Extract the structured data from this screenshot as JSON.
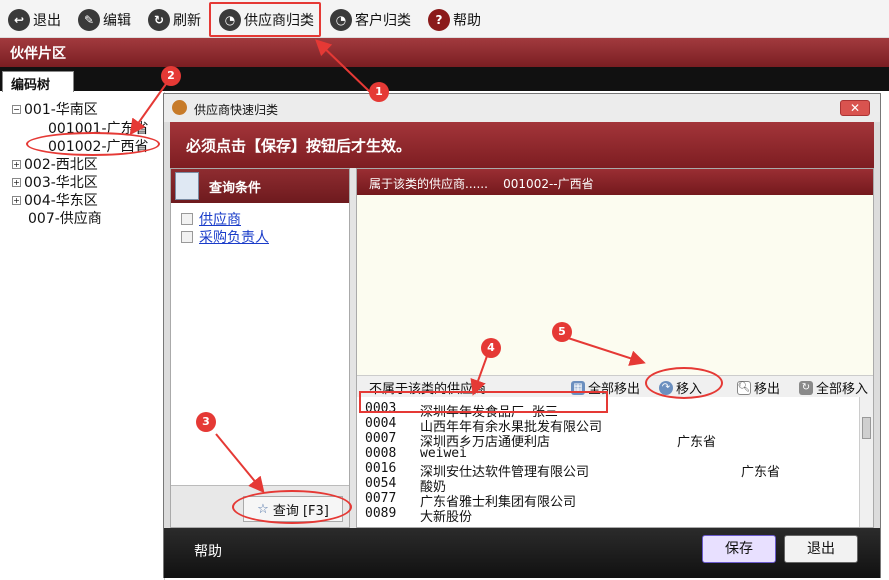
{
  "toolbar": {
    "exit": "退出",
    "edit": "编辑",
    "refresh": "刷新",
    "supplier_class": "供应商归类",
    "customer_class": "客户归类",
    "help": "帮助"
  },
  "section_title": "伙伴片区",
  "tree_tab": "编码树",
  "tree": {
    "n1": "001-华南区",
    "n1a": "001001-广东省",
    "n1b": "001002-广西省",
    "n2": "002-西北区",
    "n3": "003-华北区",
    "n4": "004-华东区",
    "n7": "007-供应商"
  },
  "dialog": {
    "title": "供应商快速归类",
    "banner": "必须点击【保存】按钮后才生效。",
    "query_header": "查询条件",
    "cond_supplier": "供应商",
    "cond_buyer": "采购负责人",
    "query_button": "查询 [F3]",
    "belongs_label": "属于该类的供应商......",
    "belongs_value": "001002--广西省",
    "not_belongs_label": "不属于该类的供应商......",
    "remove_all": "全部移出",
    "move_in": "移入",
    "move_out": "移出",
    "move_all_in": "全部移入",
    "help": "帮助",
    "save": "保存",
    "exit": "退出"
  },
  "suppliers": [
    {
      "code": "0003",
      "name": "深圳年年发食品厂 张三",
      "region": ""
    },
    {
      "code": "0004",
      "name": "山西年年有余水果批发有限公司",
      "region": ""
    },
    {
      "code": "0007",
      "name": "深圳西乡万店通便利店",
      "region": "广东省"
    },
    {
      "code": "0008",
      "name": "weiwei",
      "region": ""
    },
    {
      "code": "0016",
      "name": "深圳安仕达软件管理有限公司",
      "region": "广东省"
    },
    {
      "code": "0054",
      "name": "酸奶",
      "region": ""
    },
    {
      "code": "0077",
      "name": "广东省雅士利集团有限公司",
      "region": ""
    },
    {
      "code": "0089",
      "name": "大新股份",
      "region": ""
    }
  ],
  "annotations": [
    "1",
    "2",
    "3",
    "4",
    "5"
  ],
  "colors": {
    "accent": "#8e2c30",
    "annotation": "#e53935"
  }
}
